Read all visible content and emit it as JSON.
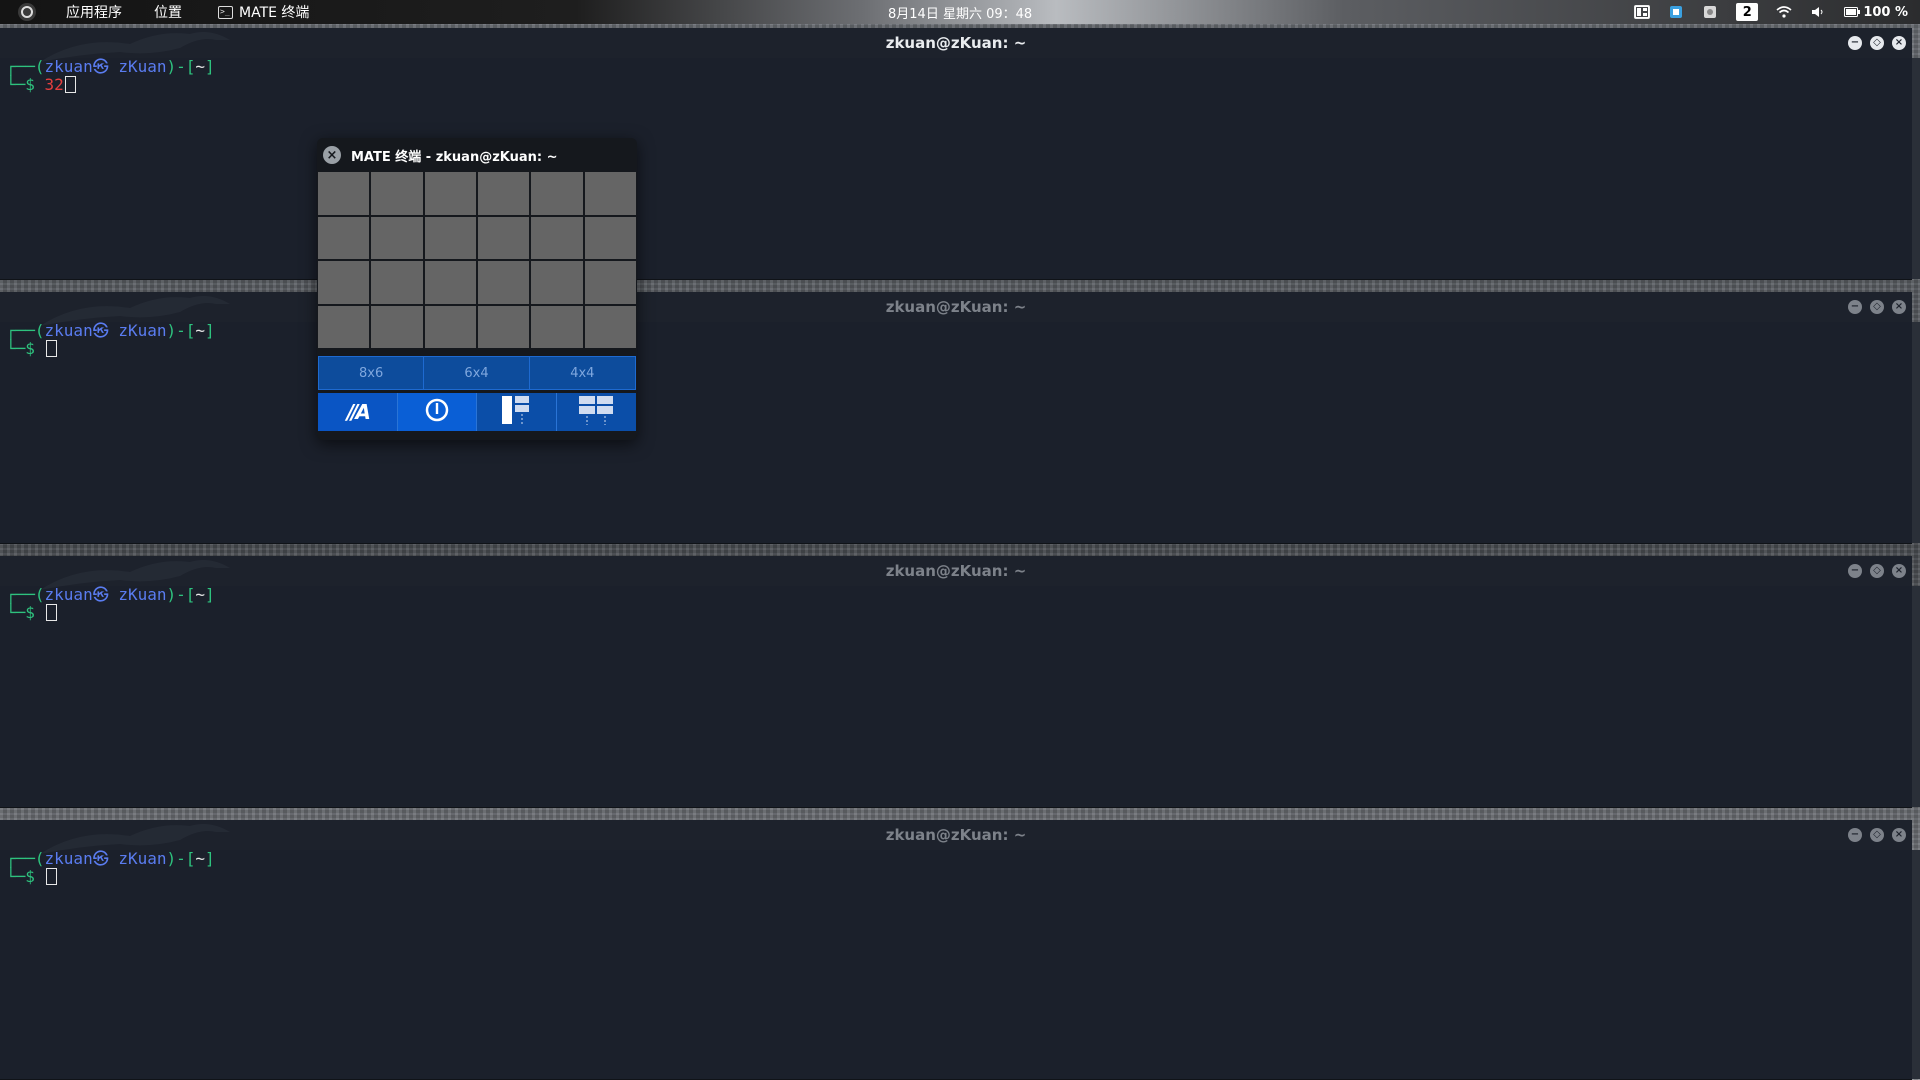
{
  "panel": {
    "menu_apps": "应用程序",
    "menu_places": "位置",
    "task_label": "MATE 终端",
    "clock": "8月14日 星期六 09：48",
    "workspace": "2",
    "battery": "100 %",
    "tray_icons": [
      "window-tile-icon",
      "network-manager-icon",
      "clipboard-icon",
      "workspace-indicator",
      "wifi-icon",
      "volume-icon",
      "battery-icon"
    ]
  },
  "terminals": [
    {
      "title": "zkuan@zKuan: ~",
      "state": "active",
      "prompt": {
        "open": "┌──(",
        "user": "zkuan㉿ zKuan",
        "close": ")-[",
        "dir": "~",
        "end": "]",
        "line2": "└─$ ",
        "input": "32"
      }
    },
    {
      "title": "zkuan@zKuan: ~",
      "state": "inactive",
      "prompt": {
        "open": "┌──(",
        "user": "zkuan㉿ zKuan",
        "close": ")-[",
        "dir": "~",
        "end": "]",
        "line2": "└─$ ",
        "input": ""
      }
    },
    {
      "title": "zkuan@zKuan: ~",
      "state": "inactive",
      "prompt": {
        "open": "┌──(",
        "user": "zkuan㉿ zKuan",
        "close": ")-[",
        "dir": "~",
        "end": "]",
        "line2": "└─$ ",
        "input": ""
      }
    },
    {
      "title": "zkuan@zKuan: ~",
      "state": "inactive",
      "prompt": {
        "open": "┌──(",
        "user": "zkuan㉿ zKuan",
        "close": ")-[",
        "dir": "~",
        "end": "]",
        "line2": "└─$ ",
        "input": ""
      }
    }
  ],
  "tile_popup": {
    "title": "MATE 终端 - zkuan@zKuan: ~",
    "grid_cols": 6,
    "grid_rows": 4,
    "presets": [
      "8x6",
      "6x4",
      "4x4"
    ],
    "actions": [
      "auto-tile-icon",
      "toggle-tiling-icon",
      "main-stack-layout-icon",
      "grid-layout-icon"
    ]
  },
  "colors": {
    "terminal_bg": "#1b202b",
    "prompt_green": "#2ec27e",
    "prompt_blue": "#5a7cf0",
    "input_red": "#e53e3e",
    "popup_blue": "#0d4c9c"
  }
}
